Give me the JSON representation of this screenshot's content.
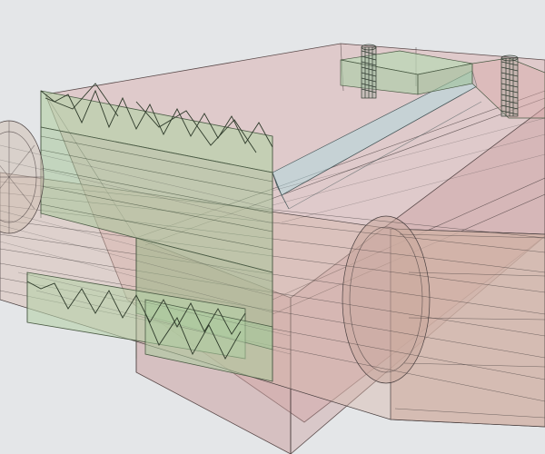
{
  "viewport": {
    "background": "#e4e6e8",
    "render_mode": "wireframe-with-translucent-fill"
  },
  "parts": [
    {
      "id": "base-plate",
      "fill": "#d9a8a8",
      "stroke": "#5a4a4a"
    },
    {
      "id": "front-gear-block",
      "fill": "#b5d1a8",
      "stroke": "#4a5a44"
    },
    {
      "id": "rear-slot-channel",
      "fill": "#b0d8de",
      "stroke": "#4a5a5c"
    },
    {
      "id": "rear-right-insert",
      "fill": "#b8d9b4",
      "stroke": "#4a5a44"
    },
    {
      "id": "shaft-cylinder",
      "fill": "#d6b9ad",
      "stroke": "#4a4040"
    },
    {
      "id": "left-shaft-stub",
      "fill": "#cfc0b3",
      "stroke": "#4a4040"
    },
    {
      "id": "threaded-pin-left",
      "stroke": "#2f3a30"
    },
    {
      "id": "threaded-pin-right",
      "stroke": "#2f3a30"
    }
  ]
}
